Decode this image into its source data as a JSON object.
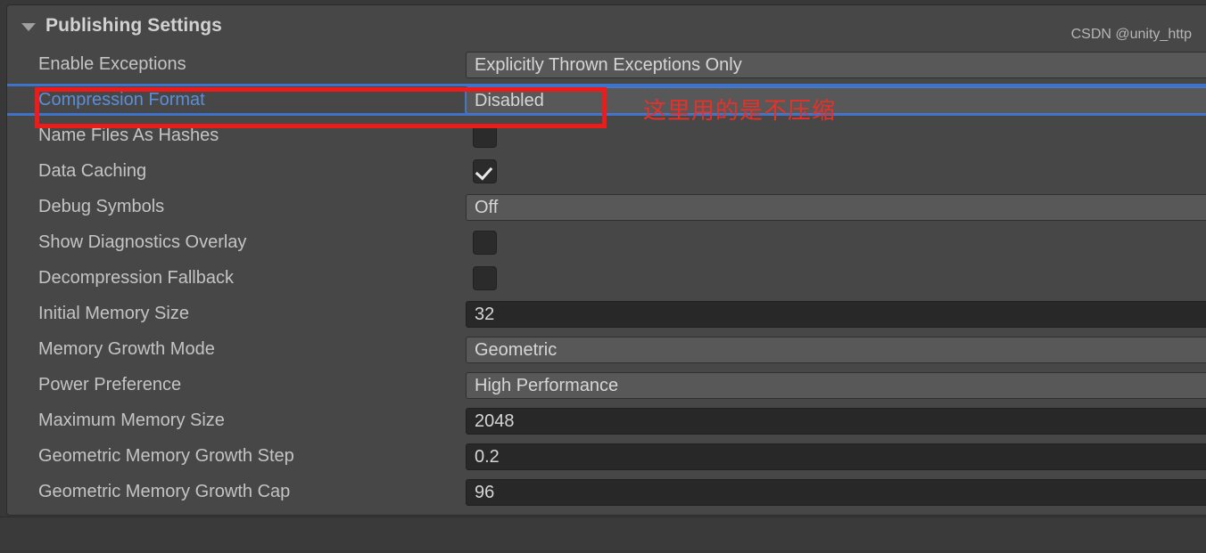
{
  "panel": {
    "foldout": {
      "title": "Publishing Settings",
      "expanded": true,
      "icon": "chevron-down-triangle-icon"
    },
    "rows": [
      {
        "label": "Enable Exceptions",
        "control": "popup",
        "value": "Explicitly Thrown Exceptions Only"
      },
      {
        "label": "Compression Format",
        "control": "popup",
        "value": "Disabled",
        "focused": true,
        "highlighted": true
      },
      {
        "label": "Name Files As Hashes",
        "control": "checkbox",
        "value": false
      },
      {
        "label": "Data Caching",
        "control": "checkbox",
        "value": true
      },
      {
        "label": "Debug Symbols",
        "control": "popup",
        "value": "Off"
      },
      {
        "label": "Show Diagnostics Overlay",
        "control": "checkbox",
        "value": false
      },
      {
        "label": "Decompression Fallback",
        "control": "checkbox",
        "value": false
      },
      {
        "label": "Initial Memory Size",
        "control": "number",
        "value": "32"
      },
      {
        "label": "Memory Growth Mode",
        "control": "popup",
        "value": "Geometric"
      },
      {
        "label": "Power Preference",
        "control": "popup",
        "value": "High Performance"
      },
      {
        "label": "Maximum Memory Size",
        "control": "number",
        "value": "2048"
      },
      {
        "label": "Geometric Memory Growth Step",
        "control": "number",
        "value": "0.2"
      },
      {
        "label": "Geometric Memory Growth Cap",
        "control": "number",
        "value": "96"
      }
    ]
  },
  "annotation": {
    "note_text": "这里用的是不压缩",
    "box_color": "#ee1b1b",
    "note_color": "#e8302a"
  },
  "footer": {
    "watermark": "CSDN @unity_http"
  },
  "colors": {
    "panel_bg": "#474747",
    "window_bg": "#383838",
    "label": "#c4c4c4",
    "label_accent": "#5b8ed6",
    "popup_bg": "#585858",
    "number_bg": "#282828",
    "selection_blue": "#3f72c9"
  }
}
